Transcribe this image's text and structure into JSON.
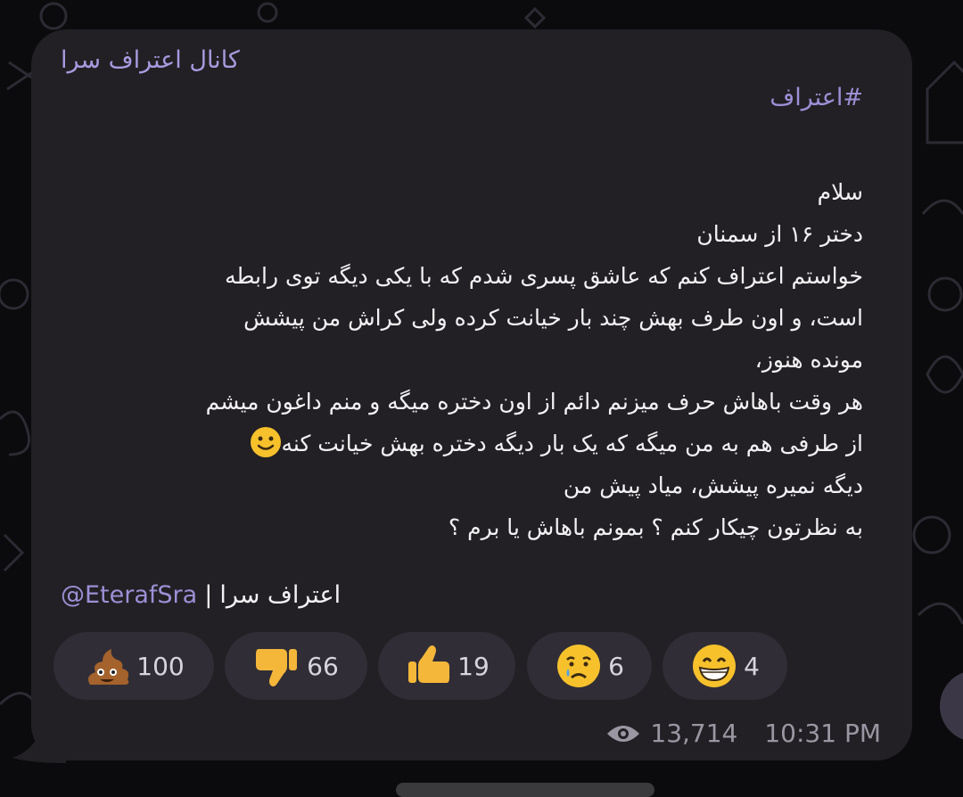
{
  "channel": {
    "name": "کانال اعتراف سرا"
  },
  "post": {
    "hashtag": "#اعتراف",
    "lines": [
      "سلام",
      "دختر ۱۶ از سمنان",
      "خواستم اعتراف کنم که عاشق پسری شدم که با یکی دیگه توی رابطه",
      "است، و اون طرف بهش چند بار خیانت کرده ولی کراش من پیشش",
      "مونده هنوز،",
      "هر وقت باهاش حرف میزنم دائم از اون دختره میگه و منم داغون میشم",
      "از طرفی هم به من میگه که یک بار دیگه دختره بهش خیانت کنه",
      "دیگه نمیره پیشش، میاد پیش من",
      "به نظرتون چیکار کنم ؟ بمونم باهاش یا برم ؟"
    ],
    "inline_emoji": "slightly-smiling-face-icon",
    "signature": {
      "name": "اعتراف سرا",
      "separator": "|",
      "handle": "@EterafSra"
    }
  },
  "reactions": [
    {
      "icon": "poo-icon",
      "count": "100"
    },
    {
      "icon": "thumbs-down-icon",
      "count": "66"
    },
    {
      "icon": "thumbs-up-icon",
      "count": "19"
    },
    {
      "icon": "crying-face-icon",
      "count": "6"
    },
    {
      "icon": "grinning-face-icon",
      "count": "4"
    }
  ],
  "meta": {
    "views": "13,714",
    "time": "10:31 PM"
  },
  "colors": {
    "bubble": "#222024",
    "accent": "#a79bdf",
    "text": "#f2f1f3",
    "chip": "#302d36"
  }
}
